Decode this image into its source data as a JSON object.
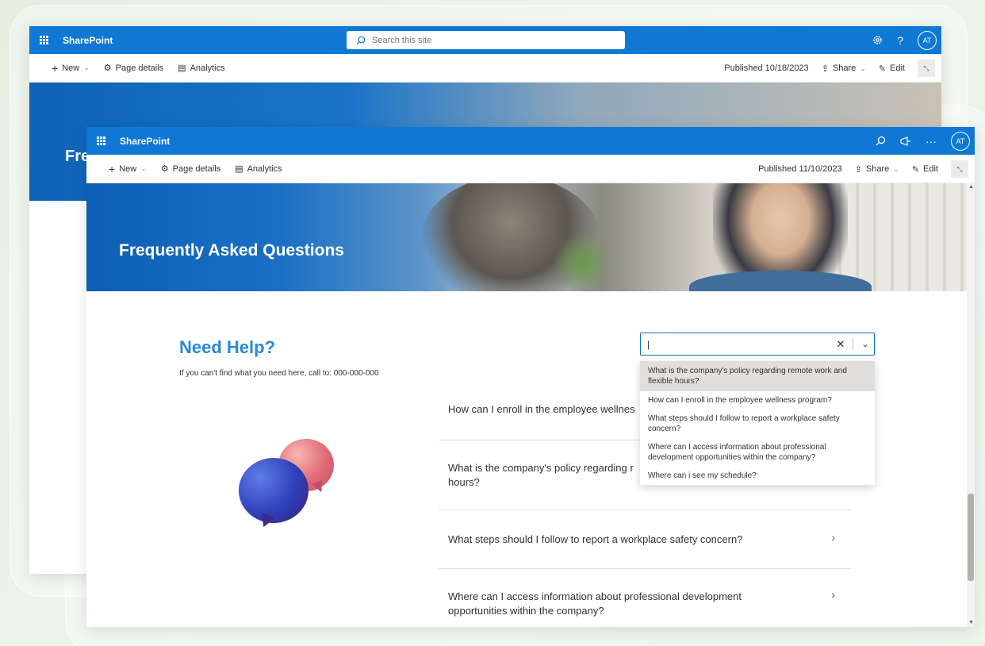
{
  "colors": {
    "suitebar": "#0f78d4",
    "accent": "#2b88d8",
    "background": "#e6f0e4"
  },
  "back_window": {
    "brand": "SharePoint",
    "search_placeholder": "Search this site",
    "toolbar": {
      "new_label": "New",
      "page_details_label": "Page details",
      "analytics_label": "Analytics",
      "published": "Published 10/18/2023",
      "share_label": "Share",
      "edit_label": "Edit"
    },
    "avatar": "AT",
    "hero_title": "Fre"
  },
  "front_window": {
    "brand": "SharePoint",
    "avatar": "AT",
    "toolbar": {
      "new_label": "New",
      "page_details_label": "Page details",
      "analytics_label": "Analytics",
      "published": "Published 11/10/2023",
      "share_label": "Share",
      "edit_label": "Edit"
    },
    "hero_title": "Frequently Asked Questions",
    "help": {
      "title": "Need Help?",
      "text": "If you can't find what you need here, call to:  000-000-000"
    },
    "combobox": {
      "value": "|"
    },
    "dropdown_options": [
      "What is the company's policy regarding remote work and flexible hours?",
      "How can I enroll in the employee wellness program?",
      "What steps should I follow to report a workplace safety concern?",
      "Where can I access information about professional development opportunities within the company?",
      "Where can i see my schedule?"
    ],
    "faq": [
      {
        "question": "How can I enroll in the employee wellnes"
      },
      {
        "question": "What is the company's policy regarding r",
        "question_cont": "hours?"
      },
      {
        "question": "What steps should I follow to report a workplace safety concern?",
        "arrow": "›"
      },
      {
        "question": "Where can I access information about professional development opportunities within the company?",
        "arrow": "›"
      }
    ]
  }
}
